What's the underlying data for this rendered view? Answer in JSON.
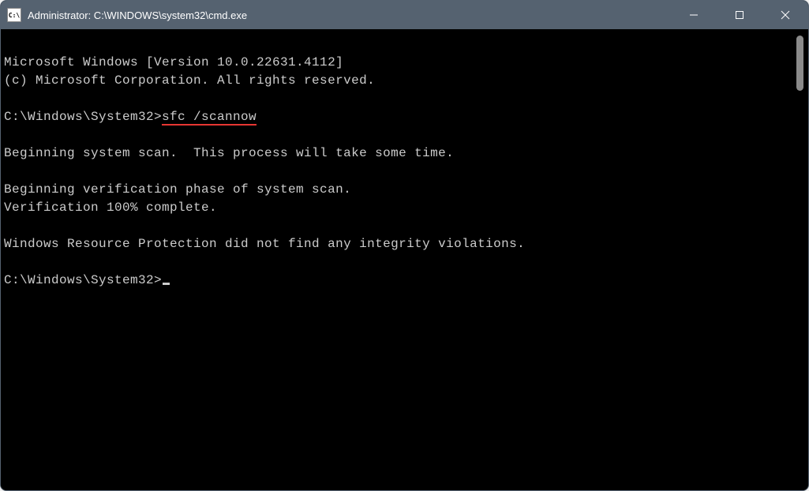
{
  "titlebar": {
    "icon_text": "C:\\",
    "title": "Administrator: C:\\WINDOWS\\system32\\cmd.exe"
  },
  "terminal": {
    "line1": "Microsoft Windows [Version 10.0.22631.4112]",
    "line2": "(c) Microsoft Corporation. All rights reserved.",
    "prompt1_path": "C:\\Windows\\System32>",
    "prompt1_command": "sfc /scannow",
    "line5": "Beginning system scan.  This process will take some time.",
    "line7": "Beginning verification phase of system scan.",
    "line8": "Verification 100% complete.",
    "line10": "Windows Resource Protection did not find any integrity violations.",
    "prompt2_path": "C:\\Windows\\System32>"
  }
}
